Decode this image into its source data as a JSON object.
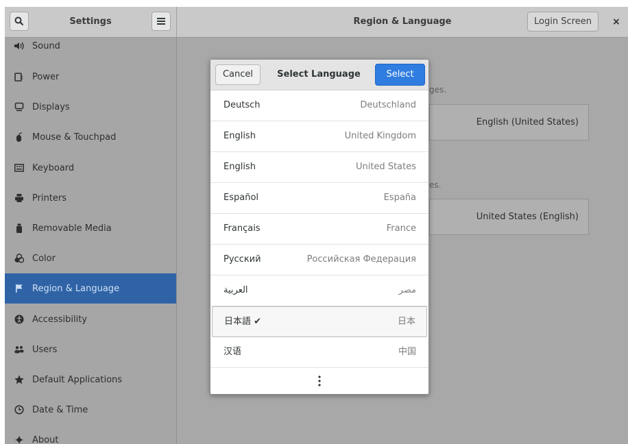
{
  "header": {
    "app_title": "Settings",
    "panel_title": "Region & Language",
    "login_screen_label": "Login Screen",
    "close_glyph": "×"
  },
  "sidebar": {
    "items": [
      {
        "label": "Sound",
        "icon": "speaker-icon"
      },
      {
        "label": "Power",
        "icon": "battery-icon"
      },
      {
        "label": "Displays",
        "icon": "display-icon"
      },
      {
        "label": "Mouse & Touchpad",
        "icon": "mouse-icon"
      },
      {
        "label": "Keyboard",
        "icon": "keyboard-icon"
      },
      {
        "label": "Printers",
        "icon": "printer-icon"
      },
      {
        "label": "Removable Media",
        "icon": "usb-icon"
      },
      {
        "label": "Color",
        "icon": "color-icon"
      },
      {
        "label": "Region & Language",
        "icon": "flag-icon",
        "active": true
      },
      {
        "label": "Accessibility",
        "icon": "accessibility-icon"
      },
      {
        "label": "Users",
        "icon": "users-icon"
      },
      {
        "label": "Default Applications",
        "icon": "star-icon"
      },
      {
        "label": "Date & Time",
        "icon": "clock-icon"
      },
      {
        "label": "About",
        "icon": "plus-sparkle-icon"
      }
    ]
  },
  "background_panel": {
    "fragment_1": "ges.",
    "fragment_2": "es.",
    "language_value": "English (United States)",
    "formats_value": "United States (English)"
  },
  "dialog": {
    "title": "Select Language",
    "cancel_label": "Cancel",
    "select_label": "Select",
    "languages": [
      {
        "name": "Deutsch",
        "region": "Deutschland"
      },
      {
        "name": "English",
        "region": "United Kingdom"
      },
      {
        "name": "English",
        "region": "United States"
      },
      {
        "name": "Español",
        "region": "España"
      },
      {
        "name": "Français",
        "region": "France"
      },
      {
        "name": "Русский",
        "region": "Российская Федерация"
      },
      {
        "name": "العربية",
        "region": "مصر"
      },
      {
        "name": "日本語 ✔",
        "region": "日本",
        "selected": true
      },
      {
        "name": "汉语",
        "region": "中国"
      }
    ]
  },
  "colors": {
    "accent": "#2f7de0",
    "sidebar_active": "#2f63a6"
  }
}
